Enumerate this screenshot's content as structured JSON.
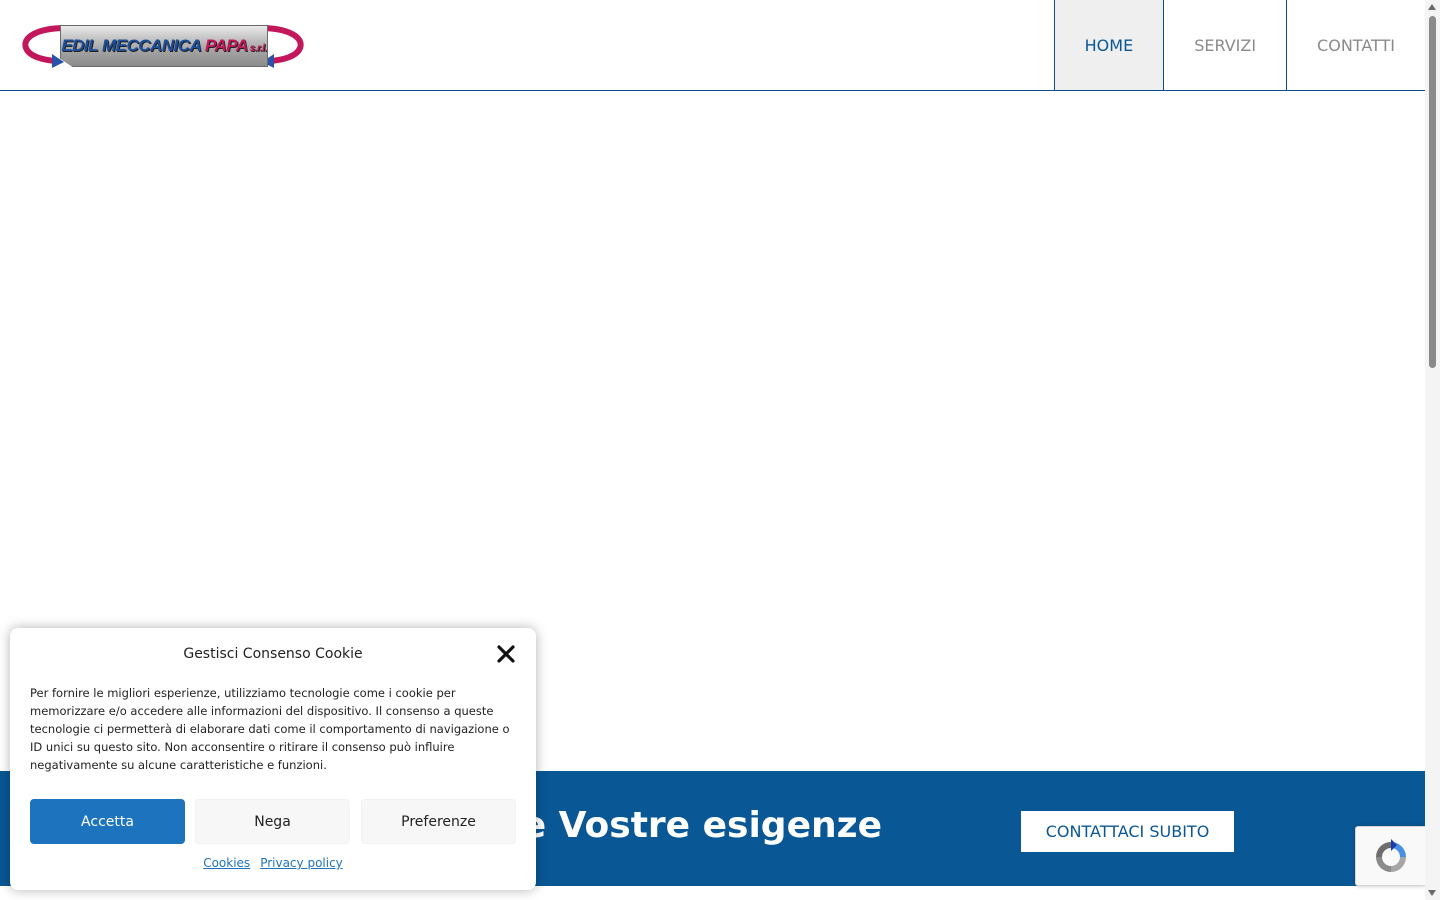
{
  "header": {
    "logo": {
      "brand_text": "EDIL MECCANICA ",
      "brand_accent": "PAPA",
      "brand_suffix": "s.r.l."
    },
    "nav": [
      {
        "label": "HOME",
        "active": true
      },
      {
        "label": "SERVIZI",
        "active": false
      },
      {
        "label": "CONTATTI",
        "active": false
      }
    ]
  },
  "cta": {
    "heading": "alle Vostre esigenze",
    "button_label": "CONTATTACI SUBITO"
  },
  "cookie_dialog": {
    "title": "Gestisci Consenso Cookie",
    "body": "Per fornire le migliori esperienze, utilizziamo tecnologie come i cookie per memorizzare e/o accedere alle informazioni del dispositivo. Il consenso a queste tecnologie ci permetterà di elaborare dati come il comportamento di navigazione o ID unici su questo sito. Non acconsentire o ritirare il consenso può influire negativamente su alcune caratteristiche e funzioni.",
    "accept_label": "Accetta",
    "deny_label": "Nega",
    "preferences_label": "Preferenze",
    "links": [
      "Cookies",
      "Privacy policy"
    ]
  },
  "colors": {
    "brand_blue": "#0a5796",
    "accept_blue": "#1e73be",
    "logo_magenta": "#c2185b"
  },
  "icons": {
    "close": "close-icon",
    "recaptcha": "recaptcha-icon"
  }
}
